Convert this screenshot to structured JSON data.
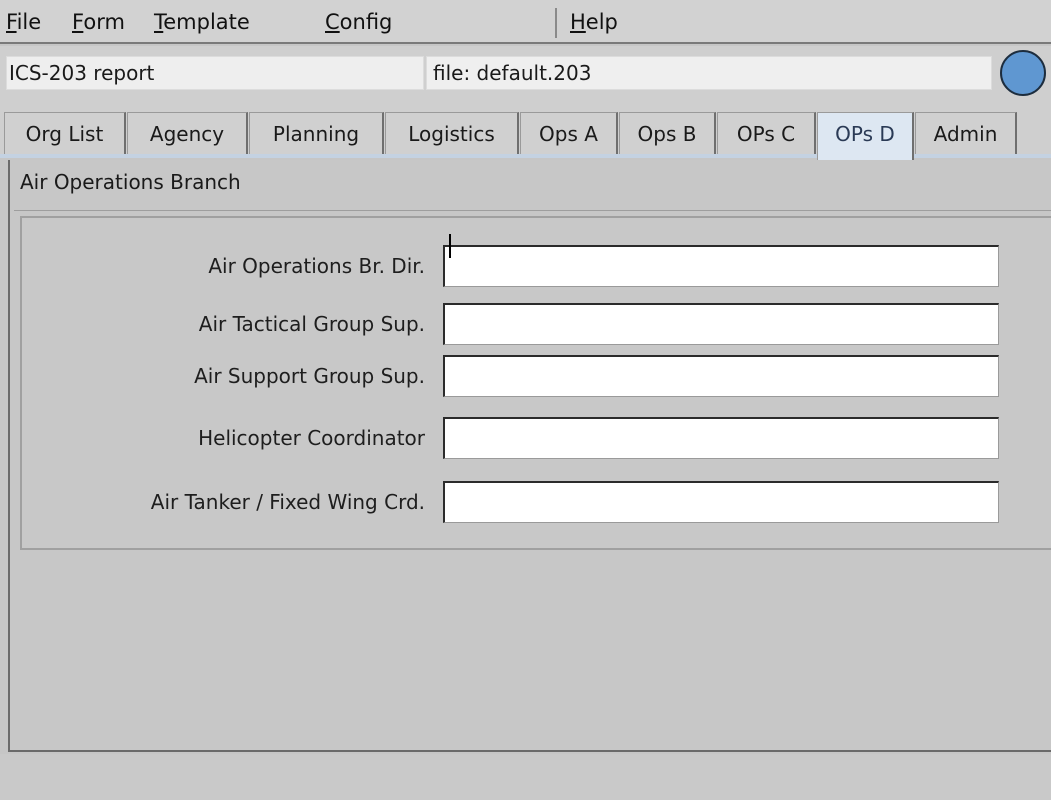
{
  "menu": {
    "items": [
      {
        "label": "File"
      },
      {
        "label": "Form"
      },
      {
        "label": "Template"
      },
      {
        "label": "Config"
      },
      {
        "label": "Help"
      }
    ]
  },
  "report": {
    "name": "ICS-203 report",
    "file": "file: default.203",
    "status_light_color": "#5f97d1"
  },
  "tabs": [
    {
      "label": "Org List"
    },
    {
      "label": "Agency"
    },
    {
      "label": "Planning"
    },
    {
      "label": "Logistics"
    },
    {
      "label": "Ops A"
    },
    {
      "label": "Ops B"
    },
    {
      "label": "OPs C"
    },
    {
      "label": "OPs D",
      "active": true
    },
    {
      "label": "Admin"
    }
  ],
  "section": {
    "title": "Air Operations Branch",
    "fields": [
      {
        "label": "Air Operations Br. Dir.",
        "value": ""
      },
      {
        "label": "Air Tactical Group Sup.",
        "value": ""
      },
      {
        "label": "Air Support Group Sup.",
        "value": ""
      },
      {
        "label": "Helicopter Coordinator",
        "value": ""
      },
      {
        "label": "Air Tanker / Fixed Wing Crd.",
        "value": ""
      }
    ]
  },
  "colors": {
    "active_tab_bg": "#dde7f2",
    "active_tab_text": "#2a3a55",
    "window_bg": "#c6c6c6"
  }
}
